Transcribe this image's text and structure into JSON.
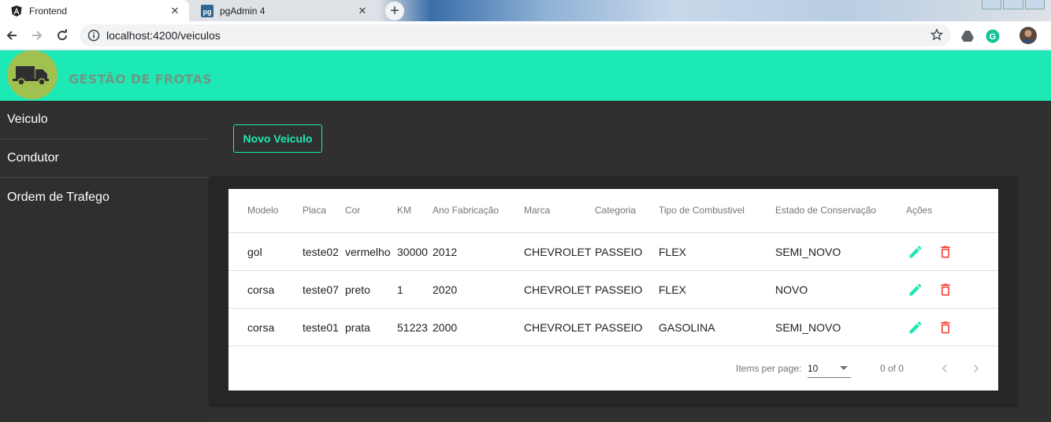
{
  "browser": {
    "tabs": [
      {
        "title": "Frontend",
        "icon": "angular-icon",
        "active": true
      },
      {
        "title": "pgAdmin 4",
        "icon": "pgadmin-icon",
        "active": false
      }
    ],
    "url": "localhost:4200/veiculos"
  },
  "app": {
    "brand": "GESTÃO DE FROTAS",
    "colors": {
      "accent": "#1de9b6",
      "delete": "#f44336",
      "logo": "#a0c14f"
    }
  },
  "sidebar": {
    "items": [
      {
        "label": "Veiculo"
      },
      {
        "label": "Condutor"
      },
      {
        "label": "Ordem de Trafego"
      }
    ]
  },
  "main": {
    "new_button": "Novo Veiculo"
  },
  "table": {
    "headers": [
      "Modelo",
      "Placa",
      "Cor",
      "KM",
      "Ano Fabricação",
      "Marca",
      "Categoria",
      "Tipo de Combustivel",
      "Estado de Conservação",
      "Ações"
    ],
    "rows": [
      [
        "gol",
        "teste02",
        "vermelho",
        "30000",
        "2012",
        "CHEVROLET",
        "PASSEIO",
        "FLEX",
        "SEMI_NOVO"
      ],
      [
        "corsa",
        "teste07",
        "preto",
        "1",
        "2020",
        "CHEVROLET",
        "PASSEIO",
        "FLEX",
        "NOVO"
      ],
      [
        "corsa",
        "teste01",
        "prata",
        "51223",
        "2000",
        "CHEVROLET",
        "PASSEIO",
        "GASOLINA",
        "SEMI_NOVO"
      ]
    ]
  },
  "paginator": {
    "items_per_page_label": "Items per page:",
    "page_size": "10",
    "range": "0 of 0"
  }
}
